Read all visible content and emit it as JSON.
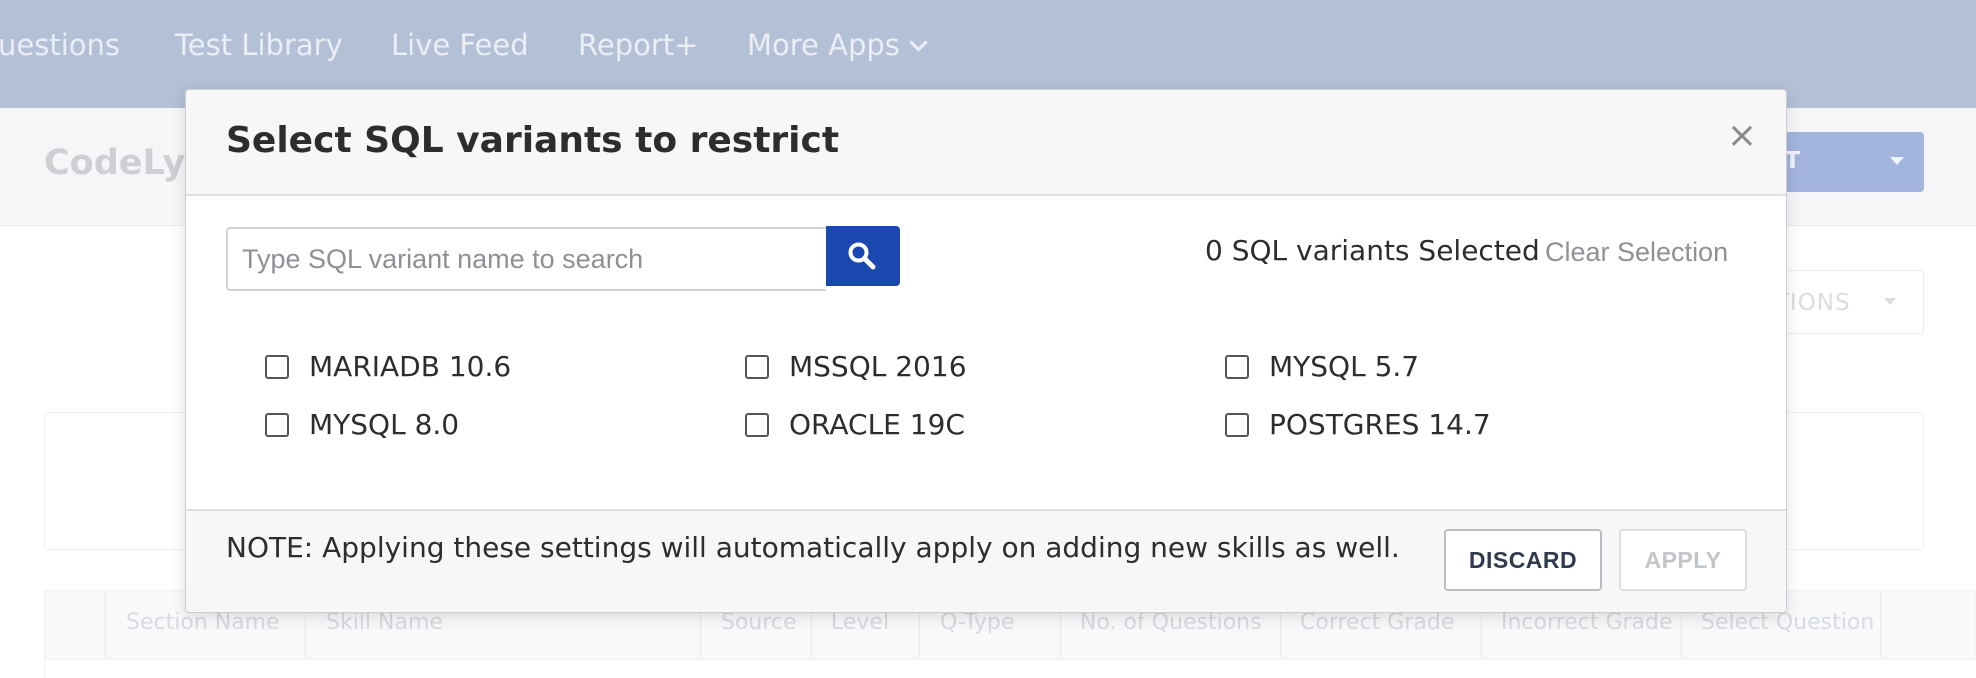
{
  "topnav": {
    "items": [
      "uestions",
      "Test Library",
      "Live Feed",
      "Report+",
      "More Apps"
    ]
  },
  "page": {
    "brand": "CodeLys",
    "action_button_label": "E TEST",
    "options_button_label": "PTIONS",
    "table_headers": [
      "Section Name",
      "Skill Name",
      "Source",
      "Level",
      "Q-Type",
      "No. of  Questions",
      "Correct Grade",
      "Incorrect Grade",
      "Select Question"
    ]
  },
  "modal": {
    "title": "Select SQL variants to restrict",
    "close_label": "×",
    "search": {
      "placeholder": "Type SQL variant name to search",
      "value": ""
    },
    "selected_count": "0 SQL variants Selected",
    "clear_selection": "Clear Selection",
    "options": [
      {
        "label": "MARIADB 10.6",
        "checked": false
      },
      {
        "label": "MSSQL 2016",
        "checked": false
      },
      {
        "label": "MYSQL 5.7",
        "checked": false
      },
      {
        "label": "MYSQL 8.0",
        "checked": false
      },
      {
        "label": "ORACLE 19C",
        "checked": false
      },
      {
        "label": "POSTGRES 14.7",
        "checked": false
      }
    ],
    "note": "NOTE: Applying these settings will automatically apply on adding new skills as well.",
    "discard_label": "DISCARD",
    "apply_label": "APPLY"
  },
  "icons": {
    "search": "search-icon",
    "close": "close-icon",
    "dropdown": "chevron-down-icon"
  },
  "colors": {
    "nav_bg": "#a4b3cd",
    "primary": "#1a47b0",
    "modal_header_bg": "#f7f7f7",
    "text": "#2d2d2d",
    "muted": "#8e9196"
  }
}
